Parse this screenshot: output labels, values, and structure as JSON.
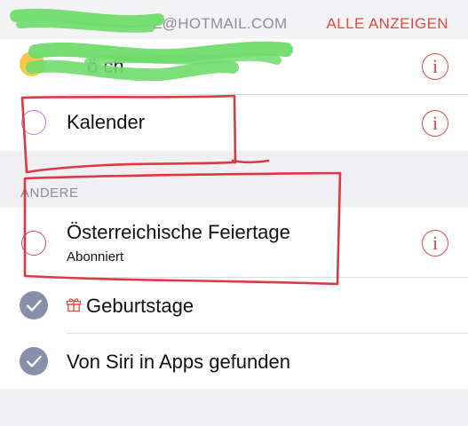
{
  "header": {
    "account_email": "Z@HOTMAIL.COM",
    "show_all_label": "ALLE ANZEIGEN"
  },
  "account_calendars": [
    {
      "label": "Kalender",
      "color": "#cc73e1",
      "selected": false
    }
  ],
  "other_section": {
    "title": "ANDERE",
    "items": [
      {
        "label": "Österreichische Feiertage",
        "subtitle": "Abonniert",
        "color": "#e0456a",
        "selected": false
      },
      {
        "label": "Geburtstage",
        "icon": "gift-icon",
        "selected": true
      },
      {
        "label": "Von Siri in Apps gefunden",
        "selected": true
      }
    ]
  },
  "colors": {
    "accent": "#e24a3d",
    "check_fill": "#8690ab",
    "redacted_scribble": "#6fdc6c",
    "annotation_outline": "#d93b43"
  }
}
